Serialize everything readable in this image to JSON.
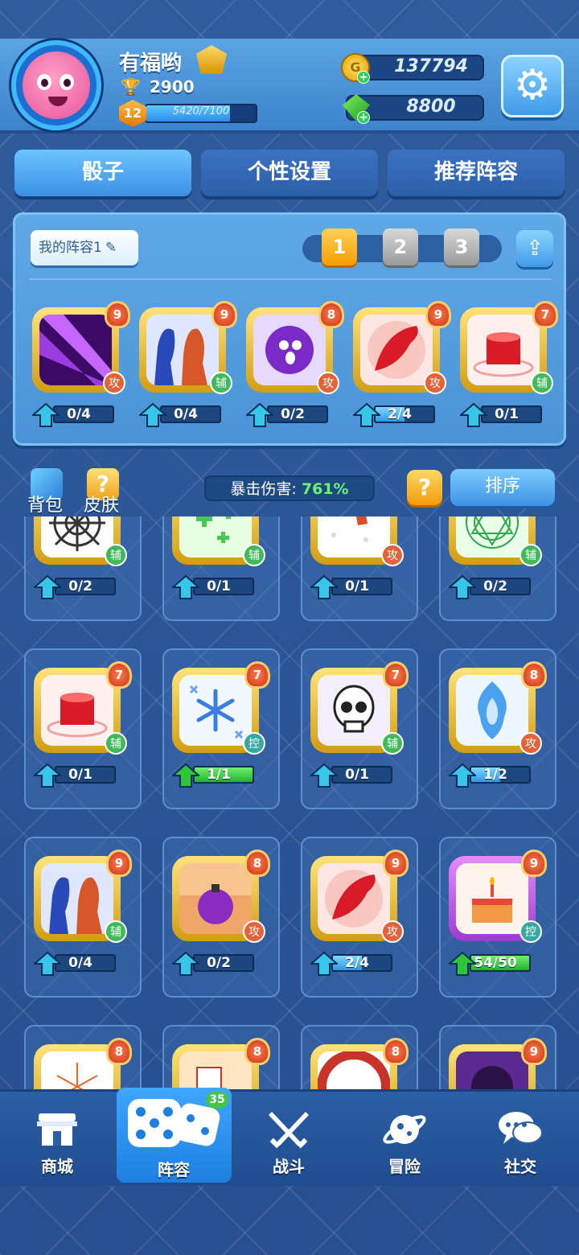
{
  "player": {
    "name": "有福哟",
    "trophies": "2900",
    "level": "12",
    "xp_text": "5420/7100",
    "xp_fraction": 0.763
  },
  "currency": {
    "gold": "137794",
    "gems": "8800"
  },
  "tabs": [
    "骰子",
    "个性设置",
    "推荐阵容"
  ],
  "loadout": {
    "name": "我的阵容1",
    "pages": [
      "1",
      "2",
      "3"
    ],
    "active_page": "1"
  },
  "loadout_dice": [
    {
      "icon": "purple-beam-icon",
      "level": "9",
      "role": "攻",
      "progress": "0/4",
      "frac": 0
    },
    {
      "icon": "silhouettes-icon",
      "level": "9",
      "role": "辅",
      "progress": "0/4",
      "frac": 0
    },
    {
      "icon": "purple-orb-icon",
      "level": "8",
      "role": "攻",
      "progress": "0/2",
      "frac": 0
    },
    {
      "icon": "red-feather-icon",
      "level": "9",
      "role": "攻",
      "progress": "2/4",
      "frac": 0.5
    },
    {
      "icon": "red-cylinder-icon",
      "level": "7",
      "role": "辅",
      "progress": "0/1",
      "frac": 0
    }
  ],
  "info": {
    "bag": "背包",
    "skin": "皮肤",
    "crit_label": "暴击伤害:",
    "crit_value": "761%",
    "help": "?",
    "sort": "排序"
  },
  "collection": [
    {
      "icon": "spiderweb-icon",
      "level": "",
      "role": "辅",
      "progress": "0/2",
      "frac": 0
    },
    {
      "icon": "green-sparkle-icon",
      "level": "",
      "role": "辅",
      "progress": "0/1",
      "frac": 0
    },
    {
      "icon": "gun-icon",
      "level": "",
      "role": "攻",
      "progress": "0/1",
      "frac": 0
    },
    {
      "icon": "magic-circle-icon",
      "level": "",
      "role": "辅",
      "progress": "0/2",
      "frac": 0
    },
    {
      "icon": "red-cylinder-icon",
      "level": "7",
      "role": "辅",
      "progress": "0/1",
      "frac": 0
    },
    {
      "icon": "snowflake-icon",
      "level": "7",
      "role": "控",
      "progress": "1/1",
      "frac": 1
    },
    {
      "icon": "skull-icon",
      "level": "7",
      "role": "辅",
      "progress": "0/1",
      "frac": 0
    },
    {
      "icon": "blue-flame-icon",
      "level": "8",
      "role": "攻",
      "progress": "1/2",
      "frac": 0.5
    },
    {
      "icon": "silhouettes-icon",
      "level": "9",
      "role": "辅",
      "progress": "0/4",
      "frac": 0
    },
    {
      "icon": "grenade-icon",
      "level": "8",
      "role": "攻",
      "progress": "0/2",
      "frac": 0
    },
    {
      "icon": "red-feather-icon",
      "level": "9",
      "role": "攻",
      "progress": "2/4",
      "frac": 0.5
    },
    {
      "icon": "cake-icon",
      "level": "9",
      "role": "控",
      "progress": "54/50",
      "frac": 1
    },
    {
      "icon": "firework-icon",
      "level": "8",
      "role": "",
      "progress": "",
      "frac": 0
    },
    {
      "icon": "cards-icon",
      "level": "8",
      "role": "",
      "progress": "",
      "frac": 0
    },
    {
      "icon": "red-ring-icon",
      "level": "8",
      "role": "",
      "progress": "",
      "frac": 0
    },
    {
      "icon": "dark-sigil-icon",
      "level": "9",
      "role": "",
      "progress": "",
      "frac": 0
    }
  ],
  "nav": [
    {
      "label": "商城",
      "icon": "shop-icon"
    },
    {
      "label": "阵容",
      "icon": "dice-icon",
      "badge": "35"
    },
    {
      "label": "战斗",
      "icon": "swords-icon"
    },
    {
      "label": "冒险",
      "icon": "planet-icon"
    },
    {
      "label": "社交",
      "icon": "chat-icon"
    }
  ],
  "colors": {
    "accent": "#3f9ae8",
    "gold": "#f59c00",
    "attack": "#e2623a",
    "support": "#3fb95a",
    "control": "#37a7a3"
  }
}
